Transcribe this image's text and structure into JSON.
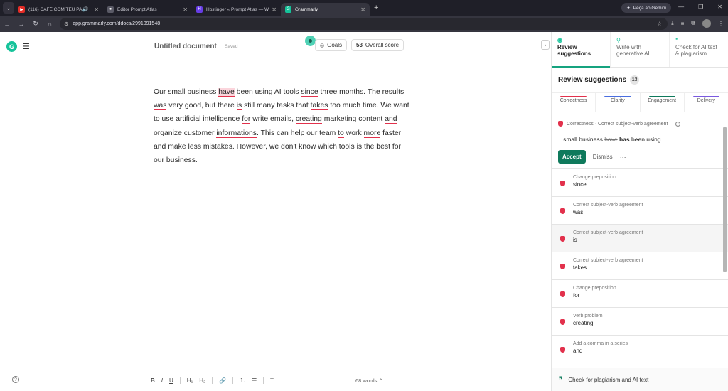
{
  "browser": {
    "tabs": [
      {
        "title": "(116) CAFÉ COM TEU PAI «",
        "fav_color": "#e52d27",
        "audio": true,
        "active": false
      },
      {
        "title": "Editor Prompt Atlas",
        "fav_color": "#5a5a66",
        "audio": false,
        "active": false
      },
      {
        "title": "Hostinger « Prompt Atlas — Wo",
        "fav_color": "#673de6",
        "audio": false,
        "active": false
      },
      {
        "title": "Grammarly",
        "fav_color": "#15c39a",
        "audio": false,
        "active": true
      }
    ],
    "gemini_label": "Peça ao Gemini",
    "url": "app.grammarly.com/ddocs/2991091548"
  },
  "doc": {
    "title": "Untitled document",
    "status": "Saved",
    "goals_label": "Goals",
    "score": "53",
    "score_label": "Overall score",
    "words": "68 words"
  },
  "panel": {
    "tabs": [
      {
        "label": "Review suggestions",
        "active": true
      },
      {
        "label": "Write with generative AI",
        "active": false
      },
      {
        "label": "Check for AI text & plagiarism",
        "active": false
      }
    ],
    "heading": "Review suggestions",
    "count": "13",
    "categories": [
      {
        "label": "Correctness",
        "color": "#e2314c"
      },
      {
        "label": "Clarity",
        "color": "#4a6ee0"
      },
      {
        "label": "Engagement",
        "color": "#0f7a5c"
      },
      {
        "label": "Delivery",
        "color": "#7a5ae0"
      }
    ],
    "main_card": {
      "crumb": "Correctness · Correct subject-verb agreement",
      "before": "...small business ",
      "old_word": "have",
      "new_word": "has",
      "after": " been using...",
      "accept": "Accept",
      "dismiss": "Dismiss",
      "more": "···"
    },
    "suggestions": [
      {
        "label": "Change preposition",
        "word": "since"
      },
      {
        "label": "Correct subject-verb agreement",
        "word": "was"
      },
      {
        "label": "Correct subject-verb agreement",
        "word": "is"
      },
      {
        "label": "Correct subject-verb agreement",
        "word": "takes"
      },
      {
        "label": "Change preposition",
        "word": "for"
      },
      {
        "label": "Verb problem",
        "word": "creating"
      },
      {
        "label": "Add a comma in a series",
        "word": "and"
      }
    ],
    "footer": "Check for plagiarism and AI text"
  },
  "text_segments": [
    {
      "t": "Our small business "
    },
    {
      "t": "have",
      "m": "hl"
    },
    {
      "t": " been using AI tools "
    },
    {
      "t": "since",
      "m": "ul"
    },
    {
      "t": " three months. The results "
    },
    {
      "t": "was",
      "m": "ul"
    },
    {
      "t": " very good, but there "
    },
    {
      "t": "is",
      "m": "ul"
    },
    {
      "t": " still many tasks that "
    },
    {
      "t": "takes",
      "m": "ul"
    },
    {
      "t": " too much time. We want to use artificial intelligence "
    },
    {
      "t": "for",
      "m": "ul"
    },
    {
      "t": " write emails, "
    },
    {
      "t": "creating",
      "m": "ul"
    },
    {
      "t": " marketing content "
    },
    {
      "t": "and",
      "m": "ul"
    },
    {
      "t": " organize customer "
    },
    {
      "t": "informations",
      "m": "ul"
    },
    {
      "t": ". This can help our team "
    },
    {
      "t": "to",
      "m": "ul"
    },
    {
      "t": " work "
    },
    {
      "t": "more",
      "m": "ul"
    },
    {
      "t": " faster and make "
    },
    {
      "t": "less",
      "m": "ul"
    },
    {
      "t": " mistakes. However, we don't know which tools "
    },
    {
      "t": "is",
      "m": "ul"
    },
    {
      "t": " the best for our business."
    }
  ]
}
